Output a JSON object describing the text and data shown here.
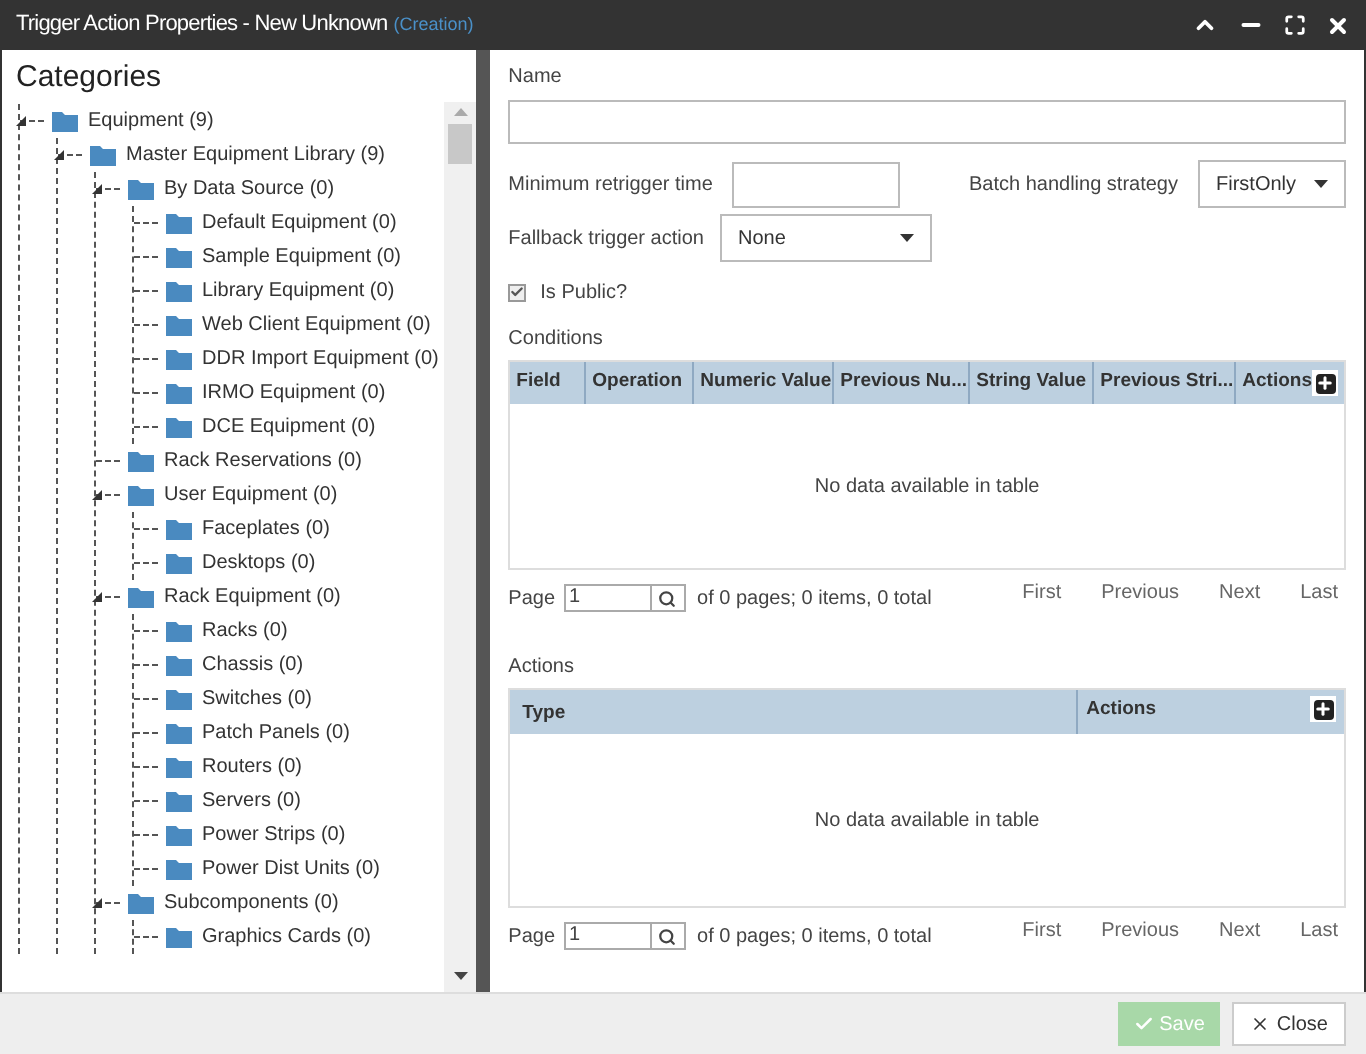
{
  "window": {
    "title": "Trigger Action Properties - New Unknown",
    "subtitle": "(Creation)"
  },
  "categories": {
    "title": "Categories",
    "tree": [
      {
        "label": "Equipment (9)",
        "children": [
          {
            "label": "Master Equipment Library (9)",
            "children": [
              {
                "label": "By Data Source (0)",
                "children": [
                  {
                    "label": "Default Equipment (0)"
                  },
                  {
                    "label": "Sample Equipment (0)"
                  },
                  {
                    "label": "Library Equipment (0)"
                  },
                  {
                    "label": "Web Client Equipment (0)"
                  },
                  {
                    "label": "DDR Import Equipment (0)"
                  },
                  {
                    "label": "IRMO Equipment (0)"
                  },
                  {
                    "label": "DCE Equipment (0)"
                  }
                ]
              },
              {
                "label": "Rack Reservations (0)"
              },
              {
                "label": "User Equipment (0)",
                "children": [
                  {
                    "label": "Faceplates (0)"
                  },
                  {
                    "label": "Desktops (0)"
                  }
                ]
              },
              {
                "label": "Rack Equipment (0)",
                "children": [
                  {
                    "label": "Racks (0)"
                  },
                  {
                    "label": "Chassis (0)"
                  },
                  {
                    "label": "Switches (0)"
                  },
                  {
                    "label": "Patch Panels (0)"
                  },
                  {
                    "label": "Routers (0)"
                  },
                  {
                    "label": "Servers (0)"
                  },
                  {
                    "label": "Power Strips (0)"
                  },
                  {
                    "label": "Power Dist Units (0)"
                  }
                ]
              },
              {
                "label": "Subcomponents (0)",
                "children": [
                  {
                    "label": "Graphics Cards (0)"
                  }
                ]
              }
            ]
          }
        ]
      }
    ]
  },
  "form": {
    "name": {
      "label": "Name"
    },
    "min_retrigger": {
      "label": "Minimum retrigger time"
    },
    "batch_strategy": {
      "label": "Batch handling strategy",
      "value": "FirstOnly"
    },
    "fallback": {
      "label": "Fallback trigger action",
      "value": "None"
    },
    "is_public": {
      "label": "Is Public?",
      "checked": true
    }
  },
  "conditions": {
    "title": "Conditions",
    "columns": [
      "Field",
      "Operation",
      "Numeric Value",
      "Previous Nu...",
      "String Value",
      "Previous Stri...",
      "Actions"
    ],
    "empty_text": "No data available in table",
    "pager": {
      "label": "Page",
      "page": "1",
      "summary": "of 0 pages; 0 items, 0 total",
      "links": [
        "First",
        "Previous",
        "Next",
        "Last"
      ]
    }
  },
  "actions": {
    "title": "Actions",
    "columns": [
      "Type",
      "Actions"
    ],
    "empty_text": "No data available in table",
    "pager": {
      "label": "Page",
      "page": "1",
      "summary": "of 0 pages; 0 items, 0 total",
      "links": [
        "First",
        "Previous",
        "Next",
        "Last"
      ]
    }
  },
  "buttons": [
    {
      "kind": "save",
      "label": "Save",
      "disabled": true
    },
    {
      "kind": "close",
      "label": "Close",
      "disabled": false
    }
  ]
}
